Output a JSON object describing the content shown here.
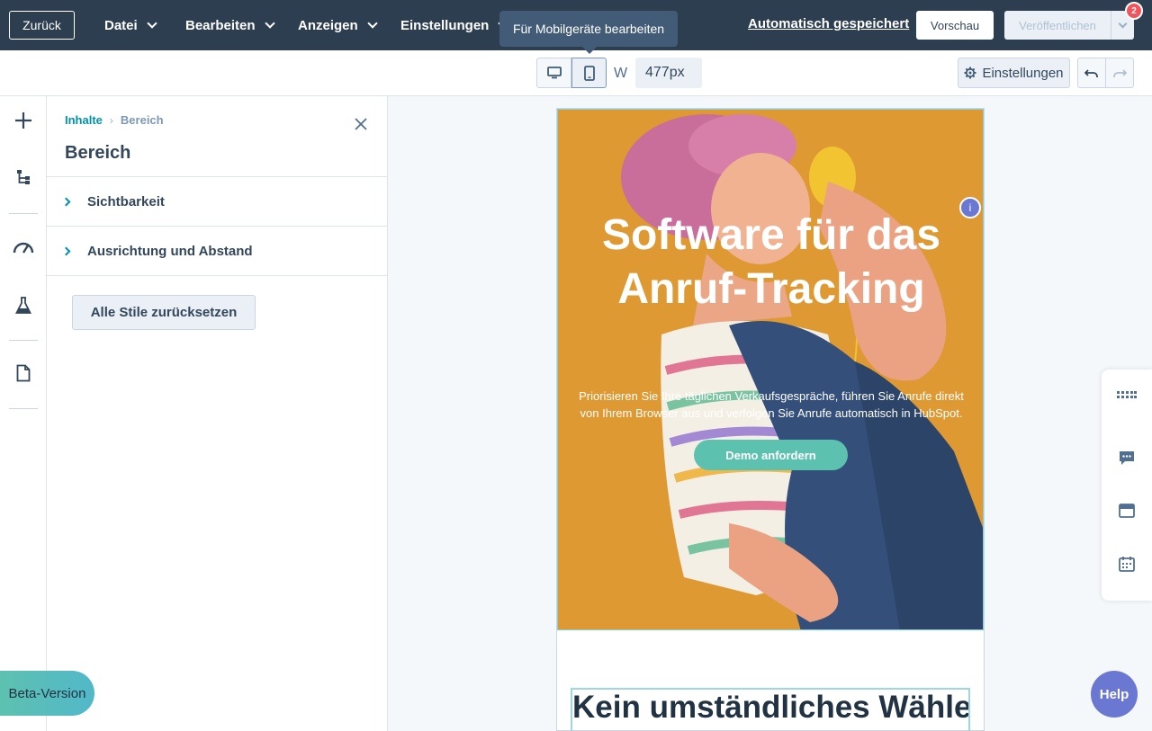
{
  "topbar": {
    "back_label": "Zurück",
    "menus": [
      "Datei",
      "Bearbeiten",
      "Anzeigen",
      "Einstellungen"
    ],
    "tooltip": "Für Mobilgeräte bearbeiten",
    "autosave": "Automatisch gespeichert",
    "preview_label": "Vorschau",
    "publish_label": "Veröffentlichen",
    "notification_count": "2"
  },
  "toolbar": {
    "devices": [
      "desktop-icon",
      "mobile-icon"
    ],
    "active_device": "mobile",
    "width_label": "W",
    "width_value": "477px",
    "settings_label": "Einstellungen"
  },
  "panel": {
    "breadcrumb_root": "Inhalte",
    "breadcrumb_current": "Bereich",
    "title": "Bereich",
    "rows": [
      "Sichtbarkeit",
      "Ausrichtung und Abstand"
    ],
    "reset_label": "Alle Stile zurücksetzen"
  },
  "hero": {
    "title": "Software für das Anruf-Tracking",
    "subtitle": "Priorisieren Sie Ihre täglichen Verkaufsgespräche, führen Sie Anrufe direkt von Ihrem Browser aus und verfolgen Sie Anrufe automatisch in HubSpot.",
    "cta": "Demo anfordern",
    "info": "i"
  },
  "section2": {
    "title": "Kein umständliches Wählen"
  },
  "beta_label": "Beta-Version",
  "help_label": "Help",
  "colors": {
    "topbar": "#2d3e50",
    "accent": "#0091ae",
    "hero_bg": "#e2a03a",
    "cta": "#5dc1b0",
    "help": "#6a78d1"
  }
}
